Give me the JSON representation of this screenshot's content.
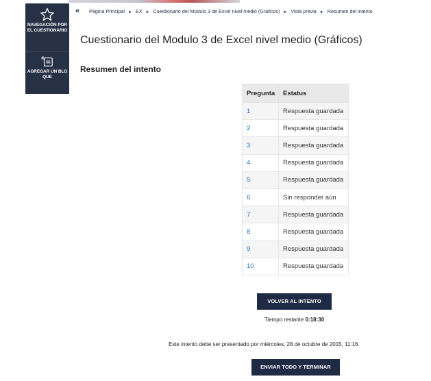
{
  "dock": {
    "nav_label": "NAVEGACIÓN POR EL CUESTIONARIO",
    "nav_icon": "star-outline-icon",
    "add_block_label": "AGREGAR UN BLOQUE",
    "add_block_icon": "add-block-icon"
  },
  "breadcrumb": {
    "collapse_glyph": "«",
    "separator": "►",
    "items": [
      "Página Principal",
      "EX",
      "Cuestionario del Modulo 3 de Excel nivel medio (Gráficos)",
      "Vista previa",
      "Resumen del intento"
    ]
  },
  "page": {
    "title": "Cuestionario del Modulo 3 de Excel nivel medio (Gráficos)",
    "section_title": "Resumen del intento"
  },
  "summary": {
    "headers": [
      "Pregunta",
      "Estatus"
    ],
    "rows": [
      {
        "question": "1",
        "status": "Respuesta guardada"
      },
      {
        "question": "2",
        "status": "Respuesta guardada"
      },
      {
        "question": "3",
        "status": "Respuesta guardada"
      },
      {
        "question": "4",
        "status": "Respuesta guardada"
      },
      {
        "question": "5",
        "status": "Respuesta guardada"
      },
      {
        "question": "6",
        "status": "Sin responder aún"
      },
      {
        "question": "7",
        "status": "Respuesta guardada"
      },
      {
        "question": "8",
        "status": "Respuesta guardada"
      },
      {
        "question": "9",
        "status": "Respuesta guardada"
      },
      {
        "question": "10",
        "status": "Respuesta guardada"
      }
    ]
  },
  "actions": {
    "return_label": "VOLVER AL INTENTO",
    "time_left_label": "Tiempo restante",
    "time_left_value": "0:18:30",
    "deadline_text": "Este intento debe ser presentado por miércoles, 28 de octubre de 2015, 11:16.",
    "submit_label": "ENVIAR TODO Y TERMINAR"
  },
  "colors": {
    "dock_bg": "#273146",
    "button_bg": "#1f2a44",
    "link": "#2a6db5"
  }
}
